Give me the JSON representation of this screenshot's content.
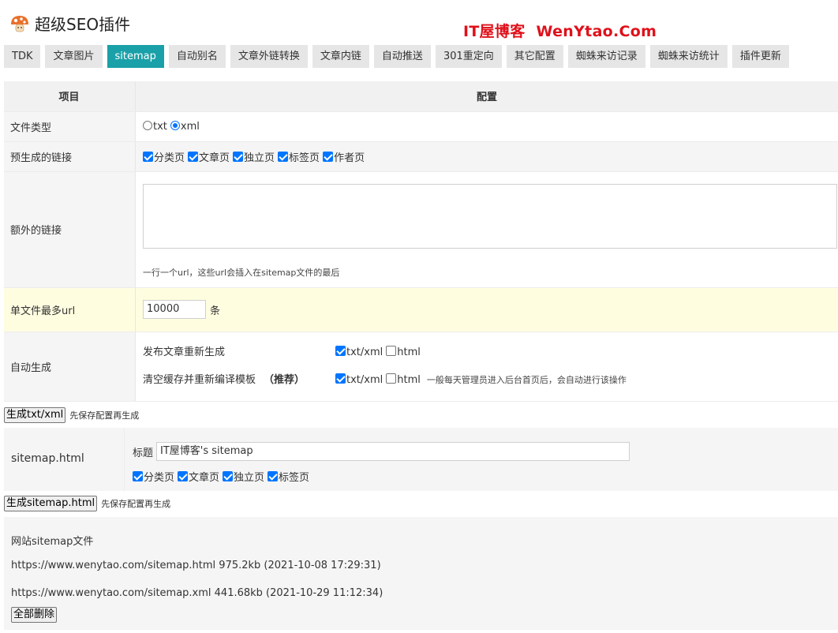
{
  "app": {
    "title": "超级SEO插件",
    "brand_name": "IT屋博客",
    "brand_domain": "WenYtao.Com",
    "brand_color": "#e0101a",
    "accent_color": "#1aa0a8",
    "logo_icon": "mushroom-icon"
  },
  "tabs": [
    {
      "label": "TDK"
    },
    {
      "label": "文章图片"
    },
    {
      "label": "sitemap",
      "active": true
    },
    {
      "label": "自动别名"
    },
    {
      "label": "文章外链转换"
    },
    {
      "label": "文章内链"
    },
    {
      "label": "自动推送"
    },
    {
      "label": "301重定向"
    },
    {
      "label": "其它配置"
    },
    {
      "label": "蜘蛛来访记录"
    },
    {
      "label": "蜘蛛来访统计"
    },
    {
      "label": "插件更新"
    }
  ],
  "table": {
    "col_item": "项目",
    "col_config": "配置",
    "file_type": {
      "label": "文件类型",
      "options": [
        {
          "label": "txt",
          "selected": false
        },
        {
          "label": "xml",
          "selected": true
        }
      ]
    },
    "pregen": {
      "label": "预生成的链接",
      "options": [
        {
          "label": "分类页",
          "checked": true
        },
        {
          "label": "文章页",
          "checked": true
        },
        {
          "label": "独立页",
          "checked": true
        },
        {
          "label": "标签页",
          "checked": true
        },
        {
          "label": "作者页",
          "checked": true
        }
      ]
    },
    "extra": {
      "label": "额外的链接",
      "value": "",
      "hint": "一行一个url，这些url会插入在sitemap文件的最后"
    },
    "max_url": {
      "label": "单文件最多url",
      "value": "10000",
      "unit": "条"
    },
    "auto": {
      "label": "自动生成",
      "line1": {
        "label": "发布文章重新生成",
        "opt1": "txt/xml",
        "opt1_checked": true,
        "opt2": "html",
        "opt2_checked": false
      },
      "line2": {
        "label": "清空缓存并重新编译模板",
        "strong": "（推荐）",
        "opt1": "txt/xml",
        "opt1_checked": true,
        "opt2": "html",
        "opt2_checked": false,
        "note": "一般每天管理员进入后台首页后，会自动进行该操作"
      }
    }
  },
  "gen_txt": {
    "button": "生成txt/xml",
    "note": "先保存配置再生成"
  },
  "html_section": {
    "label": "sitemap.html",
    "title_label": "标题",
    "title_value": "IT屋博客's sitemap",
    "options": [
      {
        "label": "分类页",
        "checked": true
      },
      {
        "label": "文章页",
        "checked": true
      },
      {
        "label": "独立页",
        "checked": true
      },
      {
        "label": "标签页",
        "checked": true
      }
    ]
  },
  "gen_html": {
    "button": "生成sitemap.html",
    "note": "先保存配置再生成"
  },
  "files": {
    "heading": "网站sitemap文件",
    "items": [
      "https://www.wenytao.com/sitemap.html 975.2kb (2021-10-08 17:29:31)",
      "https://www.wenytao.com/sitemap.xml 441.68kb (2021-10-29 11:12:34)"
    ],
    "delete_button": "全部删除"
  }
}
